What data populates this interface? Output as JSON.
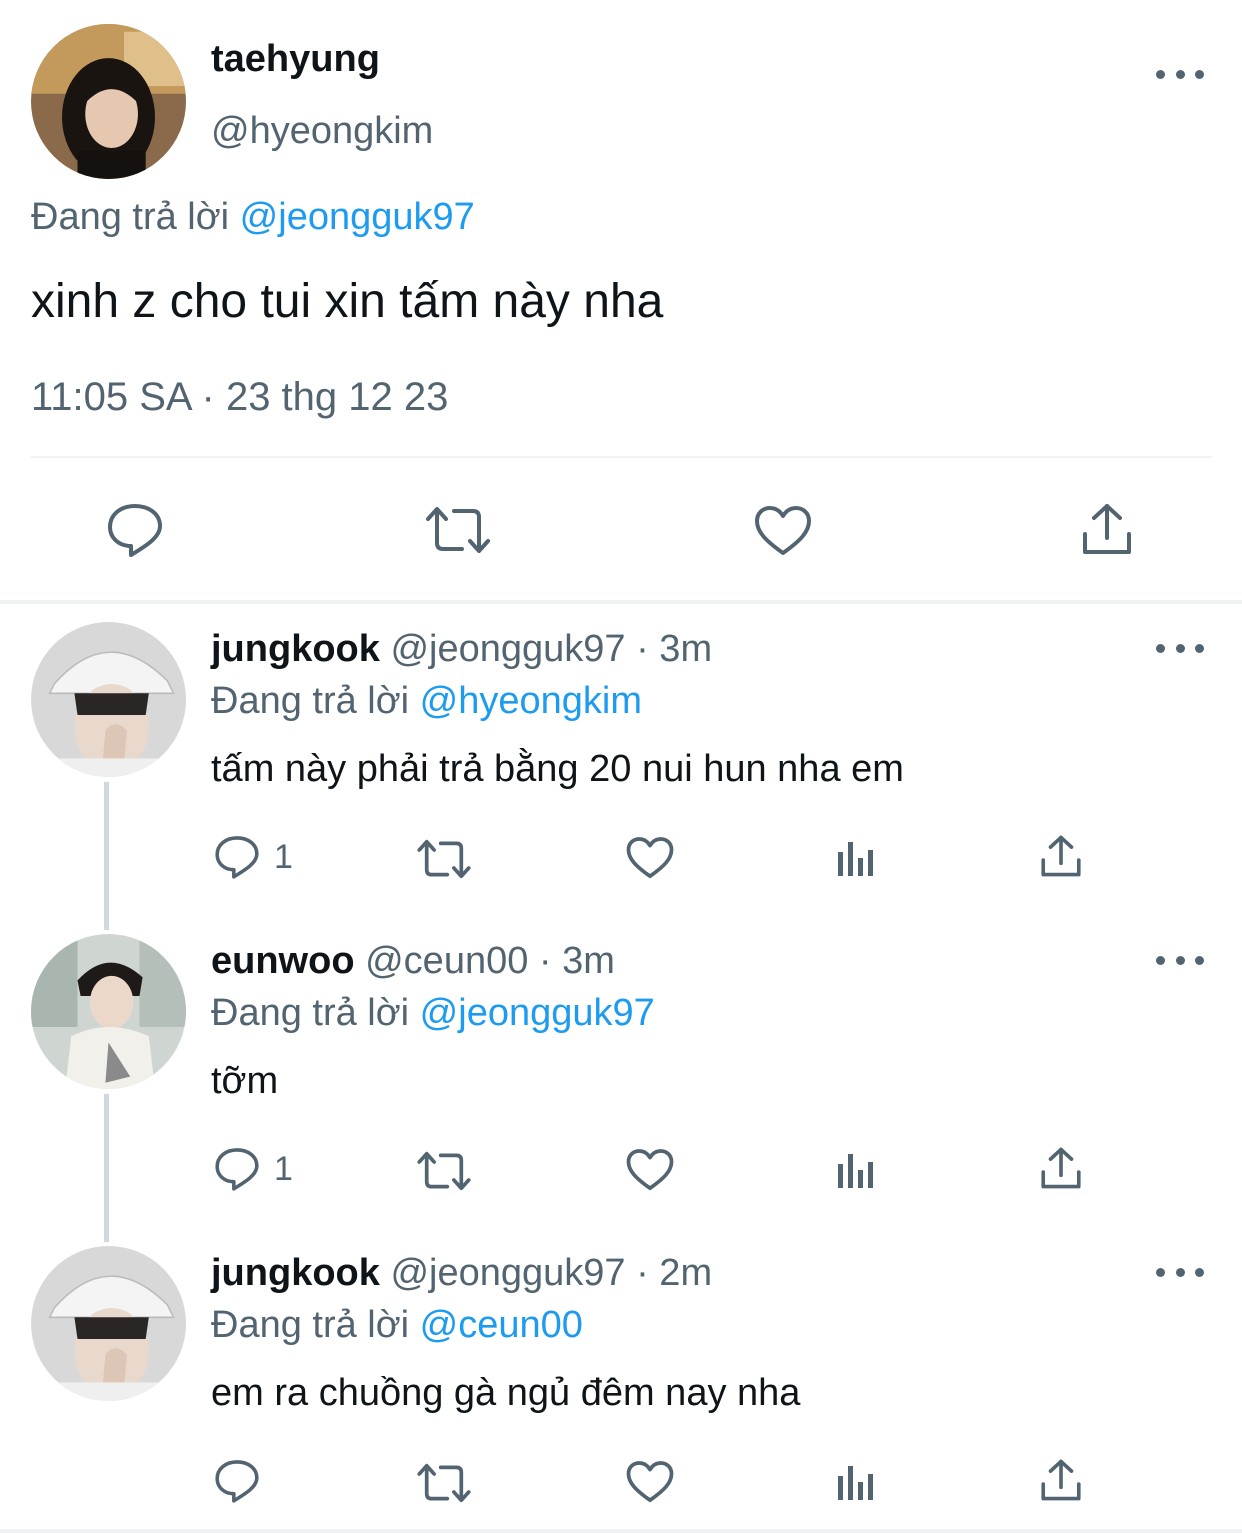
{
  "main_tweet": {
    "display_name": "taehyung",
    "handle": "@hyeongkim",
    "replying_prefix": "Đang trả lời",
    "replying_to": "@jeongguk97",
    "text": "xinh z cho tui xin tấm này nha",
    "timestamp": "11:05 SA · 23 thg 12 23",
    "actions": [
      "reply-icon",
      "retweet-icon",
      "like-icon",
      "share-icon"
    ]
  },
  "replies": [
    {
      "display_name": "jungkook",
      "handle_time": "@jeongguk97 · 3m",
      "replying_prefix": "Đang trả lời",
      "replying_to": "@hyeongkim",
      "text": "tấm này phải trả bằng 20 nui hun nha em",
      "reply_count": "1"
    },
    {
      "display_name": "eunwoo",
      "handle_time": "@ceun00 · 3m",
      "replying_prefix": "Đang trả lời",
      "replying_to": "@jeongguk97",
      "text": "tỡm",
      "reply_count": "1"
    },
    {
      "display_name": "jungkook",
      "handle_time": "@jeongguk97 · 2m",
      "replying_prefix": "Đang trả lời",
      "replying_to": "@ceun00",
      "text": "em ra chuồng gà ngủ đêm nay nha",
      "reply_count": ""
    }
  ],
  "colors": {
    "accent": "#1d9bf0",
    "secondary_text": "#536471",
    "primary_text": "#0f1419",
    "divider": "#eff3f4",
    "thread_line": "#cfd9de"
  }
}
